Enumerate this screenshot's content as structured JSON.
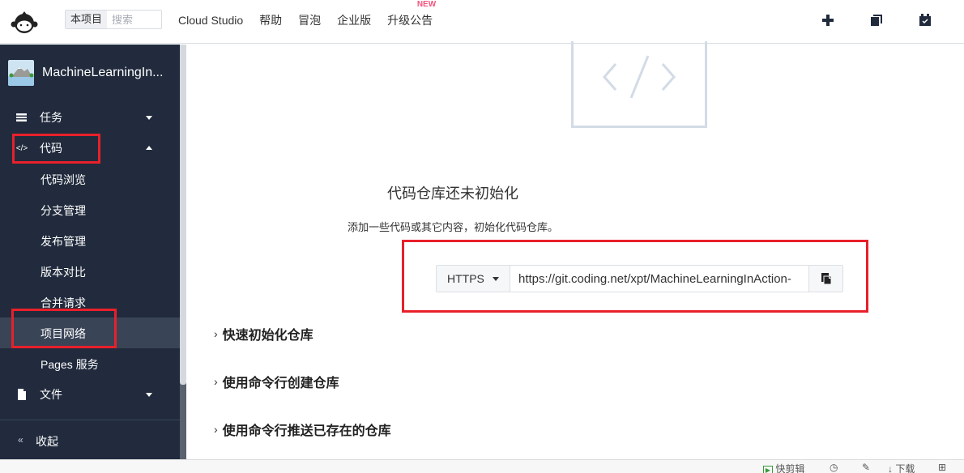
{
  "header": {
    "search_scope": "本项目",
    "search_placeholder": "搜索",
    "nav": [
      {
        "label": "Cloud Studio"
      },
      {
        "label": "帮助"
      },
      {
        "label": "冒泡"
      },
      {
        "label": "企业版"
      },
      {
        "label": "升级公告",
        "badge": "NEW"
      }
    ],
    "icons": [
      "plus-icon",
      "copy-stack-icon",
      "calendar-check-icon"
    ],
    "badge_color": "#f2557e"
  },
  "sidebar": {
    "project_name": "MachineLearningIn...",
    "menu": [
      {
        "label": "任务",
        "icon": "task-list-icon",
        "expanded": false
      },
      {
        "label": "代码",
        "icon": "code-icon",
        "expanded": true
      },
      {
        "label": "文件",
        "icon": "file-icon",
        "expanded": false
      }
    ],
    "code_submenu": [
      {
        "label": "代码浏览"
      },
      {
        "label": "分支管理"
      },
      {
        "label": "发布管理"
      },
      {
        "label": "版本对比"
      },
      {
        "label": "合并请求"
      },
      {
        "label": "项目网络",
        "active": true
      },
      {
        "label": "Pages 服务"
      }
    ],
    "collapse_label": "收起",
    "bg_color": "#212b3d",
    "active_bg_color": "#394457"
  },
  "main": {
    "empty_title": "代码仓库还未初始化",
    "empty_subtitle": "添加一些代码或其它内容，初始化代码仓库。",
    "protocol": "HTTPS",
    "repo_url": "https://git.coding.net/xpt/MachineLearningInAction-",
    "sections": [
      {
        "label": "快速初始化仓库"
      },
      {
        "label": "使用命令行创建仓库"
      },
      {
        "label": "使用命令行推送已存在的仓库"
      }
    ],
    "highlight_color": "#e8202a"
  },
  "bottombar": {
    "items": [
      {
        "label": "快剪辑",
        "icon": "play-icon"
      },
      {
        "label": "",
        "icon": "speed-icon"
      },
      {
        "label": "",
        "icon": "pin-icon"
      },
      {
        "label": "下载",
        "icon": "download-icon"
      },
      {
        "label": "",
        "icon": "window-icon"
      }
    ]
  }
}
